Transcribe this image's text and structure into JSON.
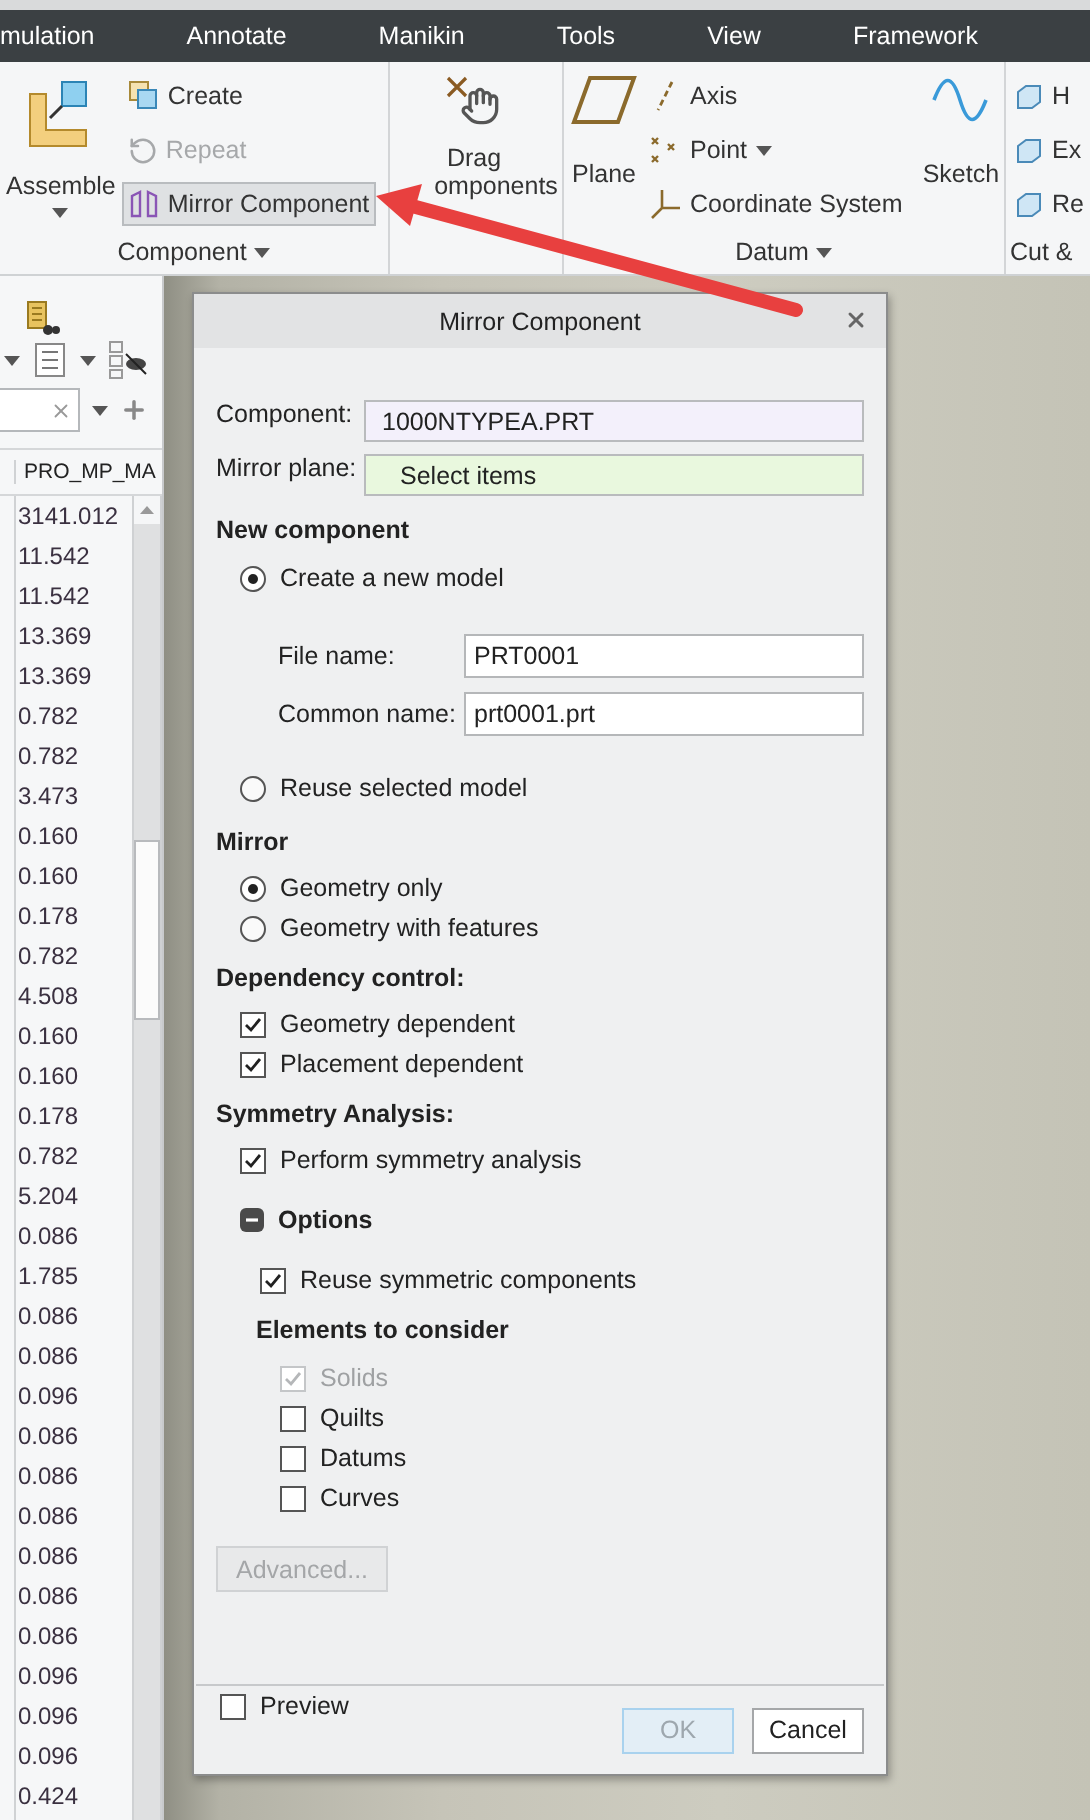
{
  "menu_tabs": [
    "mulation",
    "Annotate",
    "Manikin",
    "Tools",
    "View",
    "Framework"
  ],
  "ribbon": {
    "component_group": {
      "label": "Component",
      "assemble": "Assemble",
      "create": "Create",
      "repeat": {
        "label": "Repeat",
        "disabled": true
      },
      "mirror": {
        "label": "Mirror Component",
        "selected": true
      }
    },
    "drag_group": {
      "label_1": "Drag",
      "label_2": "omponents"
    },
    "datum_group": {
      "label": "Datum",
      "plane": "Plane",
      "axis": "Axis",
      "point": "Point",
      "coordinate_system": "Coordinate System",
      "sketch": "Sketch"
    },
    "cut_group": {
      "label": "Cut &",
      "items": [
        "H",
        "Ex",
        "Re"
      ]
    }
  },
  "model_tree": {
    "column_header": "PRO_MP_MA",
    "values": [
      "3141.012",
      "11.542",
      "11.542",
      "13.369",
      "13.369",
      "0.782",
      "0.782",
      "3.473",
      "0.160",
      "0.160",
      "0.178",
      "0.782",
      "4.508",
      "0.160",
      "0.160",
      "0.178",
      "0.782",
      "5.204",
      "0.086",
      "1.785",
      "0.086",
      "0.086",
      "0.096",
      "0.086",
      "0.086",
      "0.086",
      "0.086",
      "0.086",
      "0.086",
      "0.096",
      "0.096",
      "0.096",
      "0.424"
    ]
  },
  "dialog": {
    "title": "Mirror Component",
    "component": {
      "label": "Component:",
      "value": "1000NTYPEA.PRT"
    },
    "mirror_plane": {
      "label": "Mirror plane:",
      "value": "Select items"
    },
    "new_component": {
      "heading": "New component",
      "create": {
        "label": "Create a new model",
        "selected": true
      },
      "file_name": {
        "label": "File name:",
        "value": "PRT0001"
      },
      "common_name": {
        "label": "Common name:",
        "value": "prt0001.prt"
      },
      "reuse": {
        "label": "Reuse selected model",
        "selected": false
      }
    },
    "mirror": {
      "heading": "Mirror",
      "options": [
        {
          "label": "Geometry only",
          "selected": true
        },
        {
          "label": "Geometry with features",
          "selected": false
        }
      ]
    },
    "dependency": {
      "heading": "Dependency control:",
      "checks": [
        {
          "label": "Geometry dependent",
          "checked": true
        },
        {
          "label": "Placement dependent",
          "checked": true
        }
      ]
    },
    "symmetry": {
      "heading": "Symmetry Analysis:",
      "perform": {
        "label": "Perform symmetry analysis",
        "checked": true
      },
      "options": {
        "label": "Options",
        "expanded": true,
        "reuse": {
          "label": "Reuse symmetric components",
          "checked": true
        },
        "elements_heading": "Elements to consider",
        "elements": [
          {
            "label": "Solids",
            "checked": true,
            "disabled": true
          },
          {
            "label": "Quilts",
            "checked": false,
            "disabled": false
          },
          {
            "label": "Datums",
            "checked": false,
            "disabled": false
          },
          {
            "label": "Curves",
            "checked": false,
            "disabled": false
          }
        ]
      }
    },
    "advanced": {
      "label": "Advanced...",
      "disabled": true
    },
    "preview": {
      "label": "Preview",
      "checked": false
    },
    "buttons": [
      {
        "label": "OK",
        "disabled": true
      },
      {
        "label": "Cancel",
        "disabled": false
      }
    ]
  }
}
